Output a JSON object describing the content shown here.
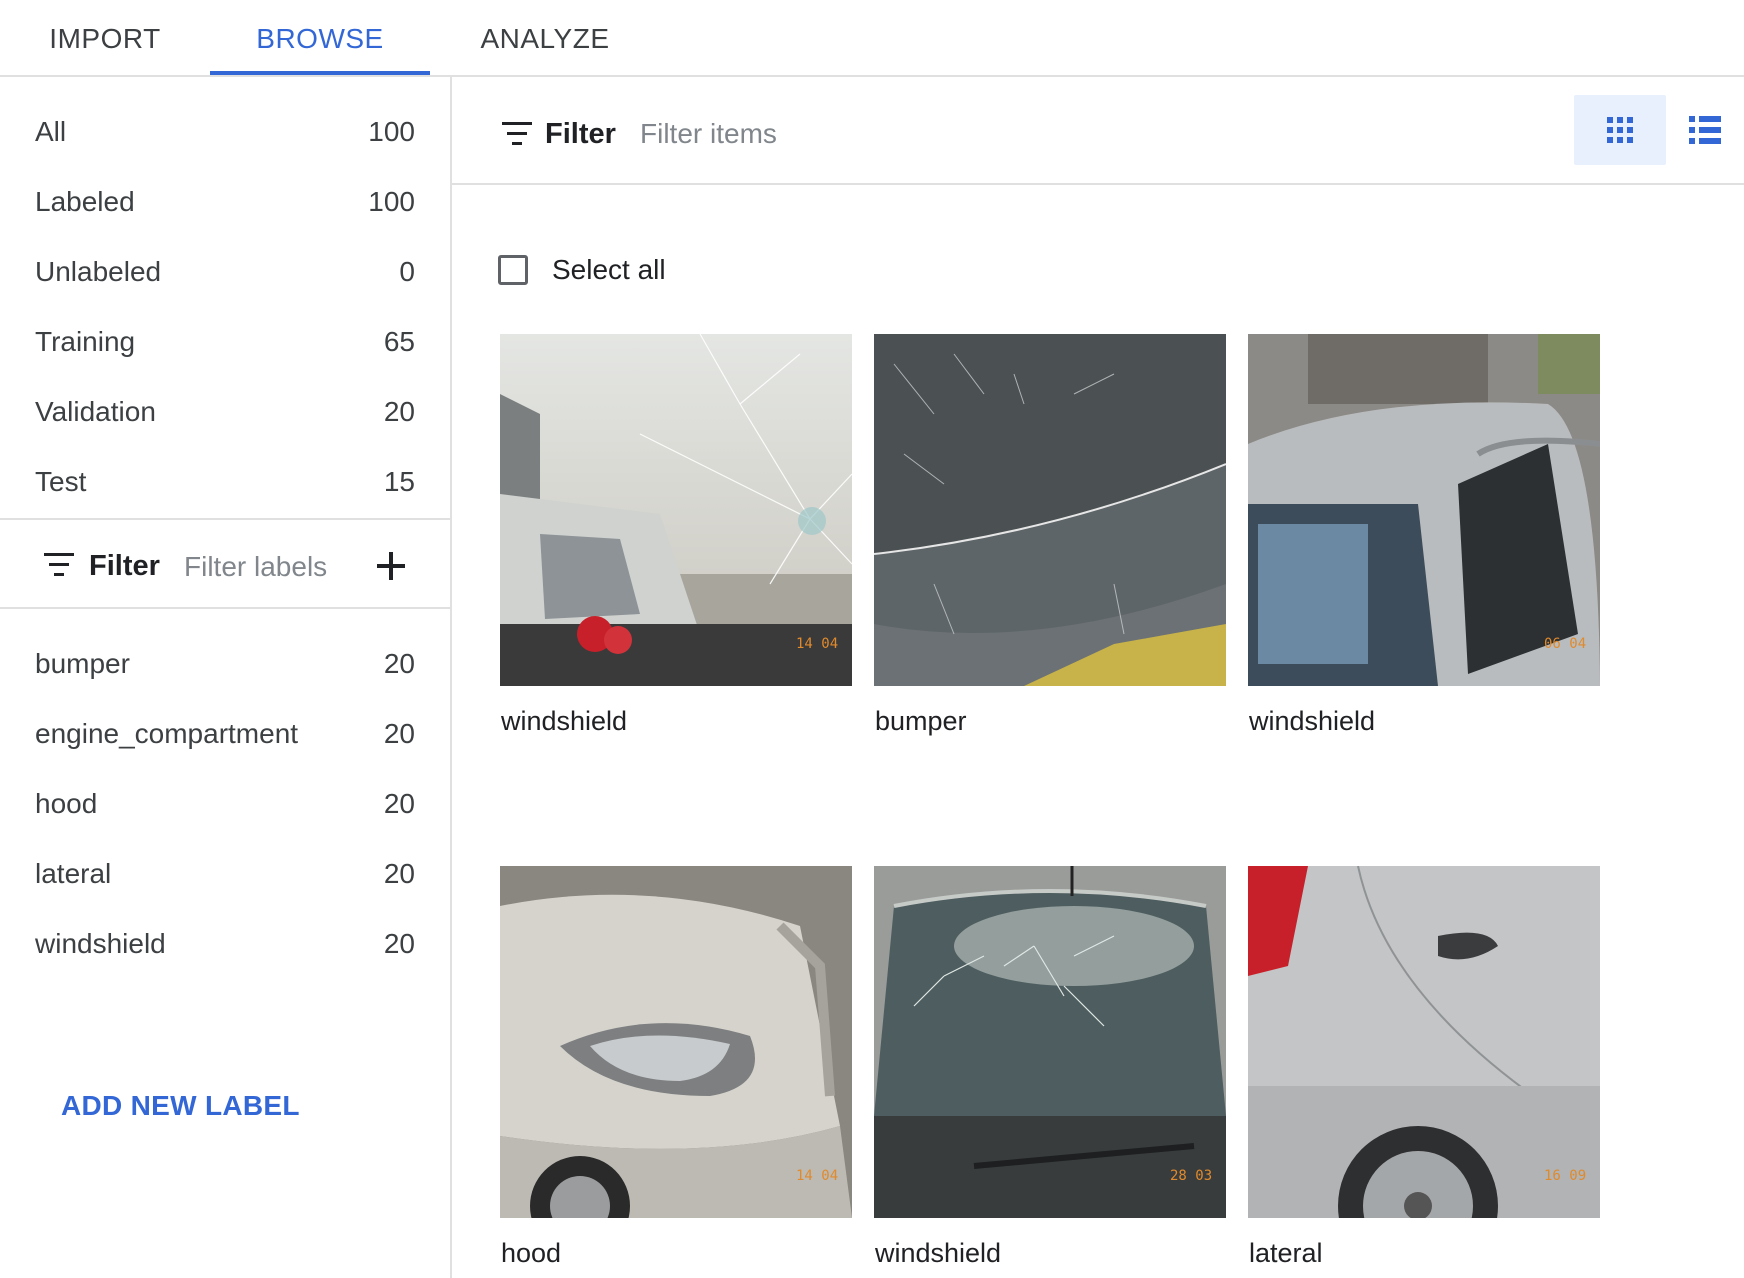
{
  "tabs": [
    {
      "label": "IMPORT",
      "active": false
    },
    {
      "label": "BROWSE",
      "active": true
    },
    {
      "label": "ANALYZE",
      "active": false
    }
  ],
  "sidebar": {
    "splits": [
      {
        "label": "All",
        "count": "100"
      },
      {
        "label": "Labeled",
        "count": "100"
      },
      {
        "label": "Unlabeled",
        "count": "0"
      },
      {
        "label": "Training",
        "count": "65"
      },
      {
        "label": "Validation",
        "count": "20"
      },
      {
        "label": "Test",
        "count": "15"
      }
    ],
    "filter": {
      "title": "Filter",
      "placeholder": "Filter labels"
    },
    "labels": [
      {
        "label": "bumper",
        "count": "20"
      },
      {
        "label": "engine_compartment",
        "count": "20"
      },
      {
        "label": "hood",
        "count": "20"
      },
      {
        "label": "lateral",
        "count": "20"
      },
      {
        "label": "windshield",
        "count": "20"
      }
    ],
    "add_label": "ADD NEW LABEL"
  },
  "main": {
    "filter": {
      "title": "Filter",
      "placeholder": "Filter items"
    },
    "view_mode": "grid",
    "select_all": "Select all",
    "items": [
      {
        "label": "windshield",
        "stamp": "14 04",
        "image": "cracked windshield"
      },
      {
        "label": "bumper",
        "stamp": "",
        "image": "scratched bumper"
      },
      {
        "label": "windshield",
        "stamp": "06 04",
        "image": "silver car roof"
      },
      {
        "label": "hood",
        "stamp": "14 04",
        "image": "dented hood"
      },
      {
        "label": "windshield",
        "stamp": "28 03",
        "image": "cracked windshield front"
      },
      {
        "label": "lateral",
        "stamp": "16 09",
        "image": "dented side panel"
      }
    ]
  },
  "colors": {
    "accent": "#3367d6",
    "text": "#202124",
    "muted": "#3c4043",
    "divider": "#e0e0e0",
    "stamp": "#e08a2c"
  }
}
